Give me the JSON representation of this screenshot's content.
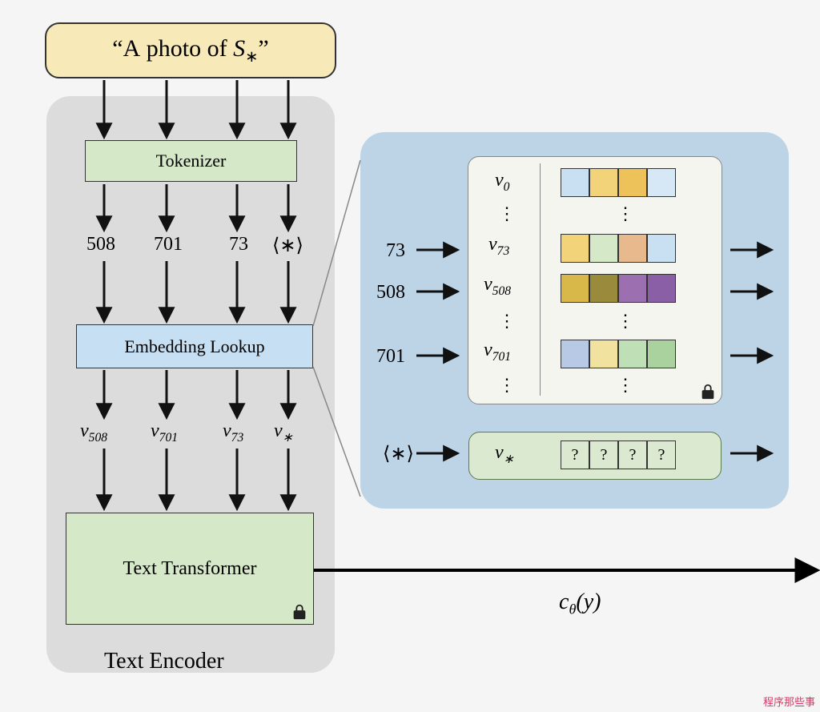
{
  "input_prompt": "“A photo of S*”",
  "blocks": {
    "tokenizer": "Tokenizer",
    "embedding": "Embedding Lookup",
    "transformer": "Text Transformer",
    "encoder_label": "Text Encoder"
  },
  "tokens": [
    "508",
    "701",
    "73",
    "⟨∗⟩"
  ],
  "embedding_outputs": [
    "v508",
    "v701",
    "v73",
    "v*"
  ],
  "lookup_inputs": [
    "73",
    "508",
    "701",
    "⟨∗⟩"
  ],
  "lookup_table": {
    "rows": [
      {
        "label": "v0",
        "colors": [
          "#c9dff2",
          "#f2d37a",
          "#eec25a",
          "#d6e7f5"
        ]
      },
      {
        "label": "v73",
        "colors": [
          "#f2d37a",
          "#d5e8c8",
          "#e8b98c",
          "#c9dff2"
        ]
      },
      {
        "label": "v508",
        "colors": [
          "#d9b84a",
          "#9a8a3c",
          "#9b6fb0",
          "#8b5fa6"
        ]
      },
      {
        "label": "v701",
        "colors": [
          "#b7c9e4",
          "#f2e2a0",
          "#bfe0b6",
          "#a9d29f"
        ]
      }
    ],
    "star_row": {
      "label": "v*",
      "cells": [
        "?",
        "?",
        "?",
        "?"
      ]
    }
  },
  "output_label": "cθ(y)",
  "watermark": "程序那些事",
  "locked_blocks": [
    "vector_table",
    "text_transformer"
  ]
}
